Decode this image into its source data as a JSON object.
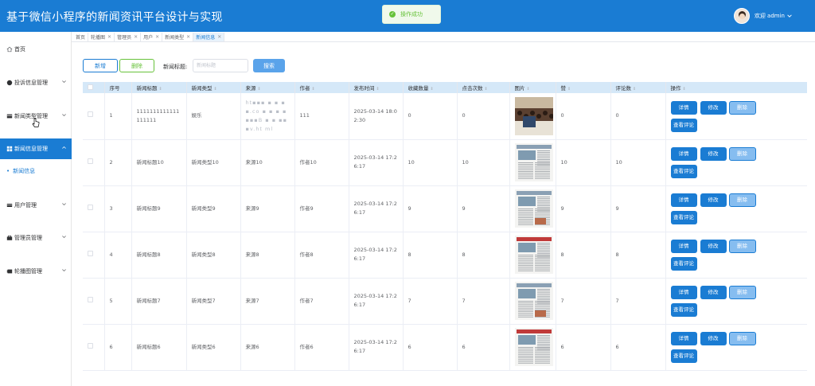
{
  "header": {
    "title": "基于微信小程序的新闻资讯平台设计与实现",
    "toast": "操作成功",
    "welcome": "欢迎 admin"
  },
  "sidebar": {
    "home": "首页",
    "items": [
      {
        "label": "投诉信息管理"
      },
      {
        "label": "新闻类型管理"
      },
      {
        "label": "新闻信息管理"
      },
      {
        "label": "用户管理"
      },
      {
        "label": "管理员管理"
      },
      {
        "label": "轮播图管理"
      }
    ],
    "sub_item": "新闻信息"
  },
  "tabs": [
    {
      "label": "首页"
    },
    {
      "label": "轮播图"
    },
    {
      "label": "管理员"
    },
    {
      "label": "用户"
    },
    {
      "label": "新闻类型"
    },
    {
      "label": "新闻信息"
    }
  ],
  "toolbar": {
    "add_label": "新增",
    "delete_label": "删除",
    "search_label": "新闻标题:",
    "search_placeholder": "新闻标题",
    "search_button": "搜索"
  },
  "table": {
    "headers": [
      "序号",
      "新闻标题",
      "新闻类型",
      "来源",
      "作者",
      "发布时间",
      "收藏数量",
      "点击次数",
      "图片",
      "赞",
      "评论数",
      "操作"
    ],
    "actions": {
      "detail": "详情",
      "edit": "修改",
      "delete": "删除",
      "comments": "查看评论"
    },
    "rows": [
      {
        "index": "1",
        "title": "1111111111111111111",
        "type": "娱乐",
        "source": "ht▪▪▪ ▪ ▪ ▪▪.co ▪ ▪ ▪ ▪ ▪▪▪B ▪ ▪ ▪▪ ▪v.ht ml",
        "author": "111",
        "time": "2025-03-14 18:02:30",
        "favorites": "0",
        "clicks": "0",
        "likes": "0",
        "comments": "0"
      },
      {
        "index": "2",
        "title": "新闻标题10",
        "type": "新闻类型10",
        "source": "来源10",
        "author": "作者10",
        "time": "2025-03-14 17:26:17",
        "favorites": "10",
        "clicks": "10",
        "likes": "10",
        "comments": "10"
      },
      {
        "index": "3",
        "title": "新闻标题9",
        "type": "新闻类型9",
        "source": "来源9",
        "author": "作者9",
        "time": "2025-03-14 17:26:17",
        "favorites": "9",
        "clicks": "9",
        "likes": "9",
        "comments": "9"
      },
      {
        "index": "4",
        "title": "新闻标题8",
        "type": "新闻类型8",
        "source": "来源8",
        "author": "作者8",
        "time": "2025-03-14 17:26:17",
        "favorites": "8",
        "clicks": "8",
        "likes": "8",
        "comments": "8"
      },
      {
        "index": "5",
        "title": "新闻标题7",
        "type": "新闻类型7",
        "source": "来源7",
        "author": "作者7",
        "time": "2025-03-14 17:26:17",
        "favorites": "7",
        "clicks": "7",
        "likes": "7",
        "comments": "7"
      },
      {
        "index": "6",
        "title": "新闻标题6",
        "type": "新闻类型6",
        "source": "来源6",
        "author": "作者6",
        "time": "2025-03-14 17:26:17",
        "favorites": "6",
        "clicks": "6",
        "likes": "6",
        "comments": "6"
      }
    ]
  },
  "colors": {
    "primary": "#1a7cd3",
    "success": "#67c23a",
    "header_bg": "#1a7cd3",
    "table_header_bg": "#d5e8f8"
  }
}
